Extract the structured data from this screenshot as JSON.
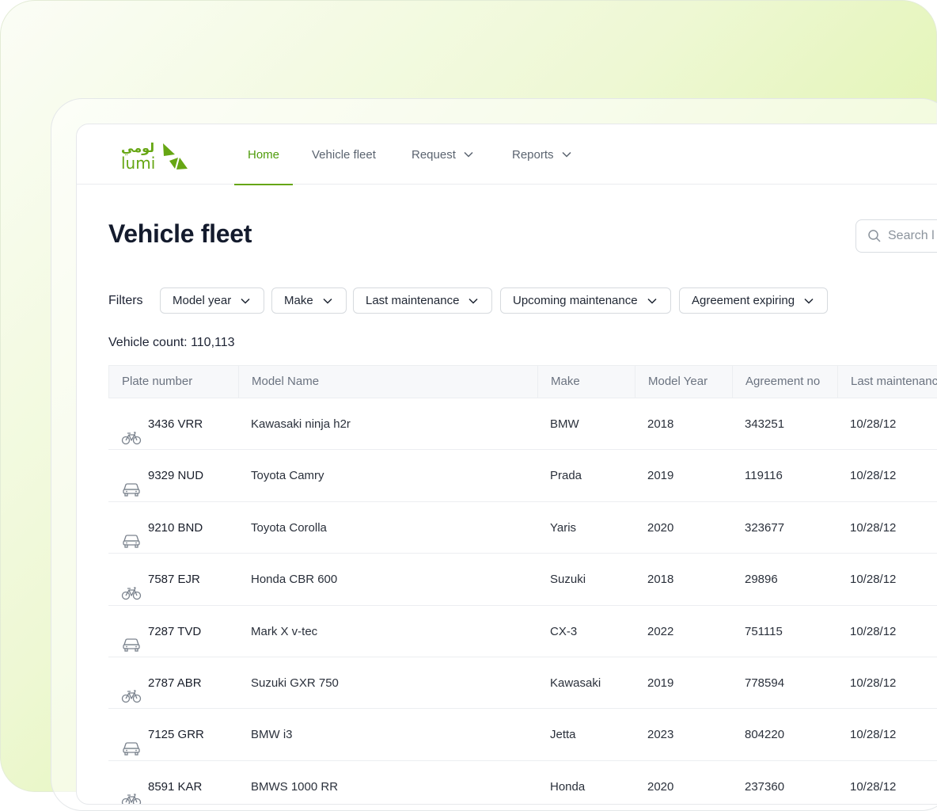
{
  "brand": {
    "arabic": "لومي",
    "latin": "lumi",
    "accent": "#66a613"
  },
  "nav": {
    "items": [
      {
        "label": "Home",
        "active": true,
        "dropdown": false
      },
      {
        "label": "Vehicle fleet",
        "active": false,
        "dropdown": false
      },
      {
        "label": "Request",
        "active": false,
        "dropdown": true
      },
      {
        "label": "Reports",
        "active": false,
        "dropdown": true
      }
    ]
  },
  "page": {
    "title": "Vehicle fleet"
  },
  "search": {
    "placeholder": "Search l"
  },
  "filters": {
    "label": "Filters",
    "items": [
      "Model year",
      "Make",
      "Last maintenance",
      "Upcoming maintenance",
      "Agreement expiring"
    ]
  },
  "vehicle_count": "Vehicle count: 110,113",
  "table": {
    "columns": [
      "Plate number",
      "Model Name",
      "Make",
      "Model Year",
      "Agreement no",
      "Last maintenance"
    ],
    "rows": [
      {
        "icon": "bicycle-icon",
        "plate": "3436 VRR",
        "model": "Kawasaki ninja h2r",
        "make": "BMW",
        "year": "2018",
        "agreement": "343251",
        "last": "10/28/12"
      },
      {
        "icon": "car-icon",
        "plate": "9329 NUD",
        "model": "Toyota Camry",
        "make": "Prada",
        "year": "2019",
        "agreement": "119116",
        "last": "10/28/12"
      },
      {
        "icon": "car-icon",
        "plate": "9210 BND",
        "model": "Toyota Corolla",
        "make": "Yaris",
        "year": "2020",
        "agreement": "323677",
        "last": "10/28/12"
      },
      {
        "icon": "bicycle-icon",
        "plate": "7587 EJR",
        "model": "Honda CBR 600",
        "make": "Suzuki",
        "year": "2018",
        "agreement": "29896",
        "last": "10/28/12"
      },
      {
        "icon": "car-icon",
        "plate": "7287 TVD",
        "model": "Mark X v-tec",
        "make": "CX-3",
        "year": "2022",
        "agreement": "751115",
        "last": "10/28/12"
      },
      {
        "icon": "bicycle-icon",
        "plate": "2787 ABR",
        "model": "Suzuki GXR 750",
        "make": "Kawasaki",
        "year": "2019",
        "agreement": "778594",
        "last": "10/28/12"
      },
      {
        "icon": "car-icon",
        "plate": "7125 GRR",
        "model": "BMW i3",
        "make": "Jetta",
        "year": "2023",
        "agreement": "804220",
        "last": "10/28/12"
      },
      {
        "icon": "bicycle-icon",
        "plate": "8591 KAR",
        "model": "BMWS 1000 RR",
        "make": "Honda",
        "year": "2020",
        "agreement": "237360",
        "last": "10/28/12"
      }
    ]
  }
}
